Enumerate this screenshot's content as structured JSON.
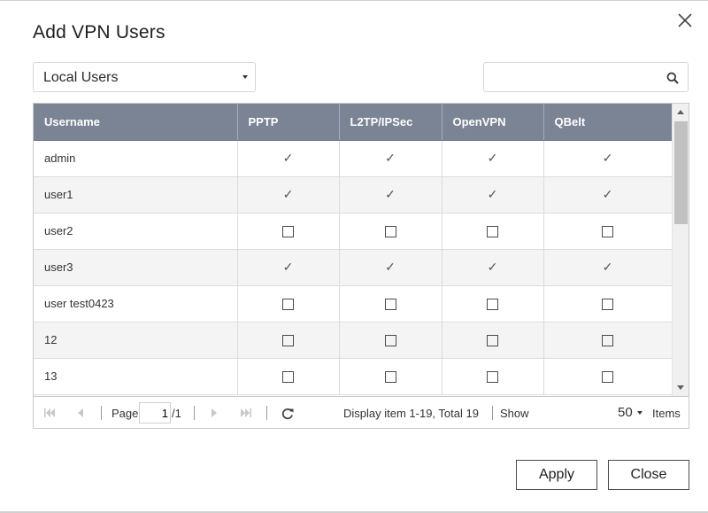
{
  "dialog": {
    "title": "Add VPN Users",
    "close_icon": "close-icon"
  },
  "filter": {
    "selected": "Local Users"
  },
  "search": {
    "value": "",
    "placeholder": "",
    "icon": "search-icon"
  },
  "table": {
    "columns": [
      "Username",
      "PPTP",
      "L2TP/IPSec",
      "OpenVPN",
      "QBelt"
    ],
    "rows": [
      {
        "username": "admin",
        "pptp": "checked",
        "l2tp": "checked",
        "openvpn": "checked",
        "qbelt": "checked"
      },
      {
        "username": "user1",
        "pptp": "checked",
        "l2tp": "checked",
        "openvpn": "checked",
        "qbelt": "checked"
      },
      {
        "username": "user2",
        "pptp": "unchecked",
        "l2tp": "unchecked",
        "openvpn": "unchecked",
        "qbelt": "unchecked"
      },
      {
        "username": "user3",
        "pptp": "checked",
        "l2tp": "checked",
        "openvpn": "checked",
        "qbelt": "checked"
      },
      {
        "username": "user test0423",
        "pptp": "unchecked",
        "l2tp": "unchecked",
        "openvpn": "unchecked",
        "qbelt": "unchecked"
      },
      {
        "username": "12",
        "pptp": "unchecked",
        "l2tp": "unchecked",
        "openvpn": "unchecked",
        "qbelt": "unchecked"
      },
      {
        "username": "13",
        "pptp": "unchecked",
        "l2tp": "unchecked",
        "openvpn": "unchecked",
        "qbelt": "unchecked"
      }
    ],
    "check_glyph": "✓"
  },
  "pagination": {
    "page_label": "Page",
    "current_page": "1",
    "total_pages": "/1",
    "display_info": "Display item 1-19, Total 19",
    "show_label": "Show",
    "page_size": "50",
    "items_label": "Items"
  },
  "buttons": {
    "apply": "Apply",
    "close": "Close"
  },
  "colors": {
    "header_bg": "#7b8494",
    "alt_row_bg": "#f4f4f4",
    "scroll_thumb": "#c1c1c1"
  }
}
